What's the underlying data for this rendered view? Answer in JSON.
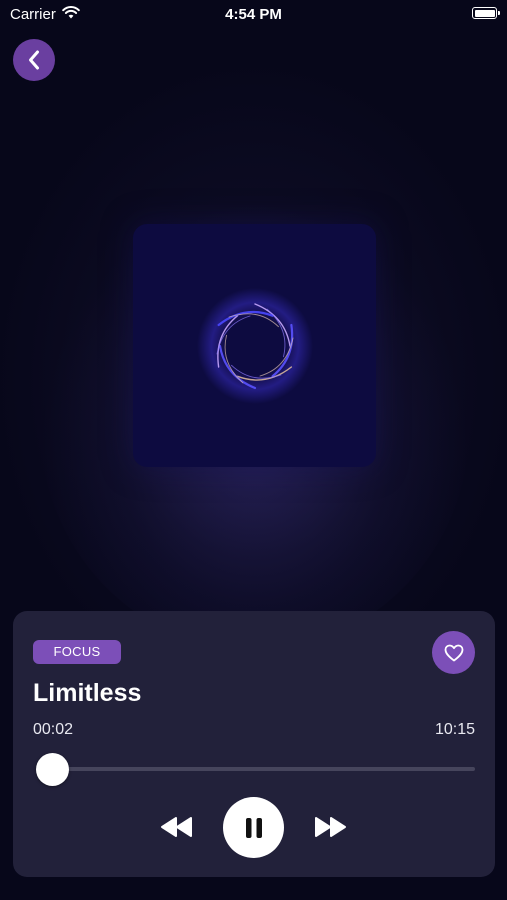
{
  "status_bar": {
    "carrier": "Carrier",
    "time": "4:54 PM"
  },
  "player": {
    "tag": "FOCUS",
    "title": "Limitless",
    "elapsed": "00:02",
    "duration": "10:15",
    "progress": 0.003,
    "state": "playing"
  },
  "icons": {
    "back": "chevron-left-icon",
    "favorite": "heart-icon",
    "rewind": "rewind-icon",
    "pause": "pause-icon",
    "forward": "fast-forward-icon"
  },
  "colors": {
    "accent": "#7c4fb8",
    "back_button": "#6a3fa0",
    "card": "#22213a",
    "background": "#07071a",
    "artwork": "#0d0b40"
  }
}
